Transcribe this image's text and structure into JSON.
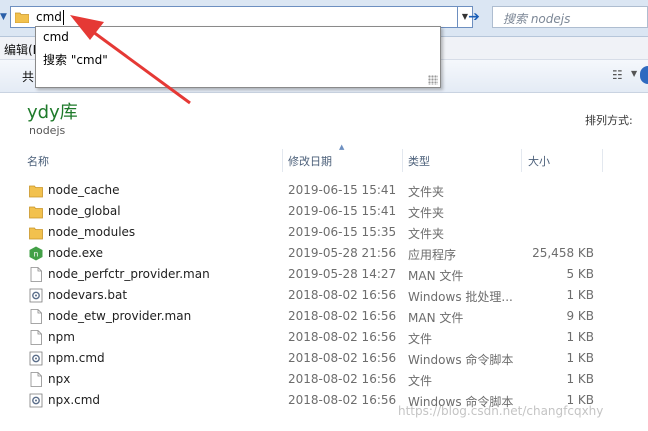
{
  "address_bar": {
    "value": "cmd",
    "search_placeholder": "搜索 nodejs"
  },
  "menu": {
    "edit_label": "编辑(E"
  },
  "toolbar": {
    "share_label": "共"
  },
  "autocomplete": {
    "items": [
      "cmd",
      "搜索 \"cmd\""
    ]
  },
  "library": {
    "title": "ydy库",
    "subtitle": "nodejs",
    "arrange_label": "排列方式:"
  },
  "columns": {
    "name": "名称",
    "date": "修改日期",
    "type": "类型",
    "size": "大小"
  },
  "files": [
    {
      "name": "node_cache",
      "date": "2019-06-15 15:41",
      "type": "文件夹",
      "size": "",
      "icon": "folder-icon"
    },
    {
      "name": "node_global",
      "date": "2019-06-15 15:41",
      "type": "文件夹",
      "size": "",
      "icon": "folder-icon"
    },
    {
      "name": "node_modules",
      "date": "2019-06-15 15:35",
      "type": "文件夹",
      "size": "",
      "icon": "folder-icon"
    },
    {
      "name": "node.exe",
      "date": "2019-05-28 21:56",
      "type": "应用程序",
      "size": "25,458 KB",
      "icon": "nodejs-exe-icon"
    },
    {
      "name": "node_perfctr_provider.man",
      "date": "2019-05-28 14:27",
      "type": "MAN 文件",
      "size": "5 KB",
      "icon": "document-icon"
    },
    {
      "name": "nodevars.bat",
      "date": "2018-08-02 16:56",
      "type": "Windows 批处理...",
      "size": "1 KB",
      "icon": "batch-file-icon"
    },
    {
      "name": "node_etw_provider.man",
      "date": "2018-08-02 16:56",
      "type": "MAN 文件",
      "size": "9 KB",
      "icon": "document-icon"
    },
    {
      "name": "npm",
      "date": "2018-08-02 16:56",
      "type": "文件",
      "size": "1 KB",
      "icon": "document-icon"
    },
    {
      "name": "npm.cmd",
      "date": "2018-08-02 16:56",
      "type": "Windows 命令脚本",
      "size": "1 KB",
      "icon": "batch-file-icon"
    },
    {
      "name": "npx",
      "date": "2018-08-02 16:56",
      "type": "文件",
      "size": "1 KB",
      "icon": "document-icon"
    },
    {
      "name": "npx.cmd",
      "date": "2018-08-02 16:56",
      "type": "Windows 命令脚本",
      "size": "1 KB",
      "icon": "batch-file-icon"
    }
  ],
  "watermark": "https://blog.csdn.net/changfcqxhy",
  "colors": {
    "library_title": "#1e7a2a",
    "annotation_arrow": "#e53935",
    "folder": "#f2c14e"
  }
}
